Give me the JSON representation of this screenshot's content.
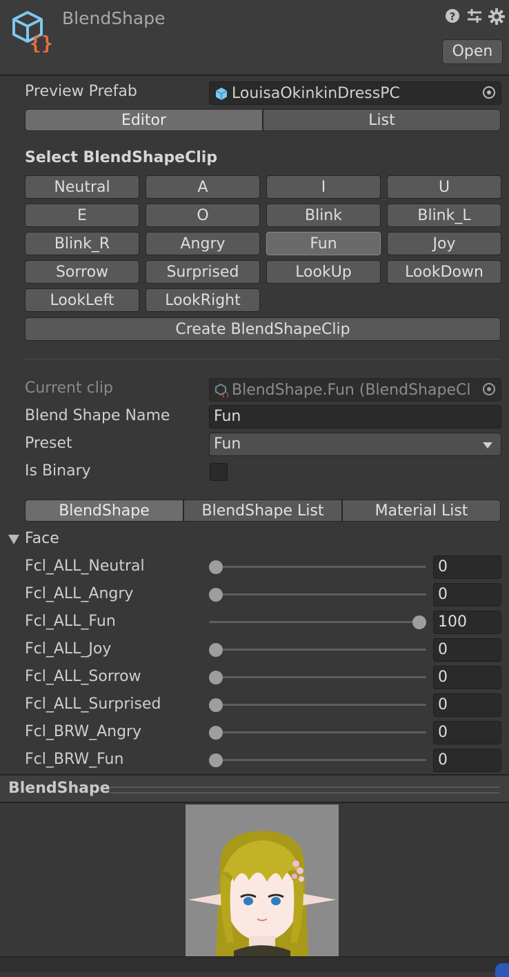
{
  "header": {
    "title": "BlendShape",
    "open_label": "Open",
    "icons": [
      "help-icon",
      "preset-sliders-icon",
      "gear-icon"
    ]
  },
  "preview_prefab": {
    "label": "Preview Prefab",
    "value": "LouisaOkinkinDressPC"
  },
  "mode_tabs": [
    {
      "label": "Editor",
      "selected": true
    },
    {
      "label": "List",
      "selected": false
    }
  ],
  "select_clip": {
    "title": "Select BlendShapeClip",
    "buttons": [
      "Neutral",
      "A",
      "I",
      "U",
      "E",
      "O",
      "Blink",
      "Blink_L",
      "Blink_R",
      "Angry",
      "Fun",
      "Joy",
      "Sorrow",
      "Surprised",
      "LookUp",
      "LookDown",
      "LookLeft",
      "LookRight"
    ],
    "selected": "Fun",
    "create_label": "Create BlendShapeClip"
  },
  "clip": {
    "current_clip_label": "Current clip",
    "current_clip_value": "BlendShape.Fun (BlendShapeCl",
    "name_label": "Blend Shape Name",
    "name_value": "Fun",
    "preset_label": "Preset",
    "preset_value": "Fun",
    "binary_label": "Is Binary",
    "binary_checked": false
  },
  "detail_tabs": [
    {
      "label": "BlendShape",
      "selected": true
    },
    {
      "label": "BlendShape List",
      "selected": false
    },
    {
      "label": "Material List",
      "selected": false
    }
  ],
  "face": {
    "label": "Face",
    "slider_range": [
      0,
      100
    ],
    "shapes": [
      {
        "name": "Fcl_ALL_Neutral",
        "value": "0"
      },
      {
        "name": "Fcl_ALL_Angry",
        "value": "0"
      },
      {
        "name": "Fcl_ALL_Fun",
        "value": "100"
      },
      {
        "name": "Fcl_ALL_Joy",
        "value": "0"
      },
      {
        "name": "Fcl_ALL_Sorrow",
        "value": "0"
      },
      {
        "name": "Fcl_ALL_Surprised",
        "value": "0"
      },
      {
        "name": "Fcl_BRW_Angry",
        "value": "0"
      },
      {
        "name": "Fcl_BRW_Fun",
        "value": "0"
      }
    ]
  },
  "preview": {
    "title": "BlendShape"
  },
  "colors": {
    "background": "#383838",
    "button": "#585858",
    "field": "#2a2a2a",
    "icon_blue": "#7fc7f0",
    "icon_orange": "#e8703a"
  }
}
